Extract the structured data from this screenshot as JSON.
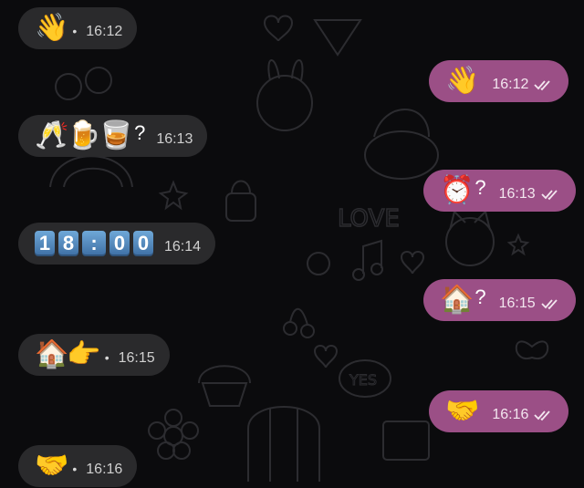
{
  "messages": [
    {
      "side": "in",
      "emoji": "👋",
      "suffix": "",
      "time": "16:12"
    },
    {
      "side": "out",
      "emoji": "👋",
      "suffix": "",
      "time": "16:12"
    },
    {
      "side": "in",
      "emoji": "🥂🍺🥃",
      "suffix": "?",
      "time": "16:13"
    },
    {
      "side": "out",
      "emoji": "⏰",
      "suffix": "?",
      "time": "16:13"
    },
    {
      "side": "in",
      "digits": [
        "1",
        "8",
        ":",
        "0",
        "0"
      ],
      "time": "16:14"
    },
    {
      "side": "out",
      "emoji": "🏠",
      "suffix": "?",
      "time": "16:15"
    },
    {
      "side": "in",
      "emoji": "🏠👉",
      "suffix": "",
      "time": "16:15"
    },
    {
      "side": "out",
      "emoji": "🤝",
      "suffix": "",
      "time": "16:16"
    },
    {
      "side": "in",
      "emoji": "🤝",
      "suffix": "",
      "time": "16:16"
    }
  ],
  "colors": {
    "background": "#0b0b0d",
    "incoming_bubble": "#2a2a2c",
    "outgoing_bubble": "#9b4f86",
    "wallpaper_lines": "#2c2c30",
    "digit_tile": "#4f86bd"
  },
  "icons": [
    "read-receipt-double-check-icon"
  ]
}
